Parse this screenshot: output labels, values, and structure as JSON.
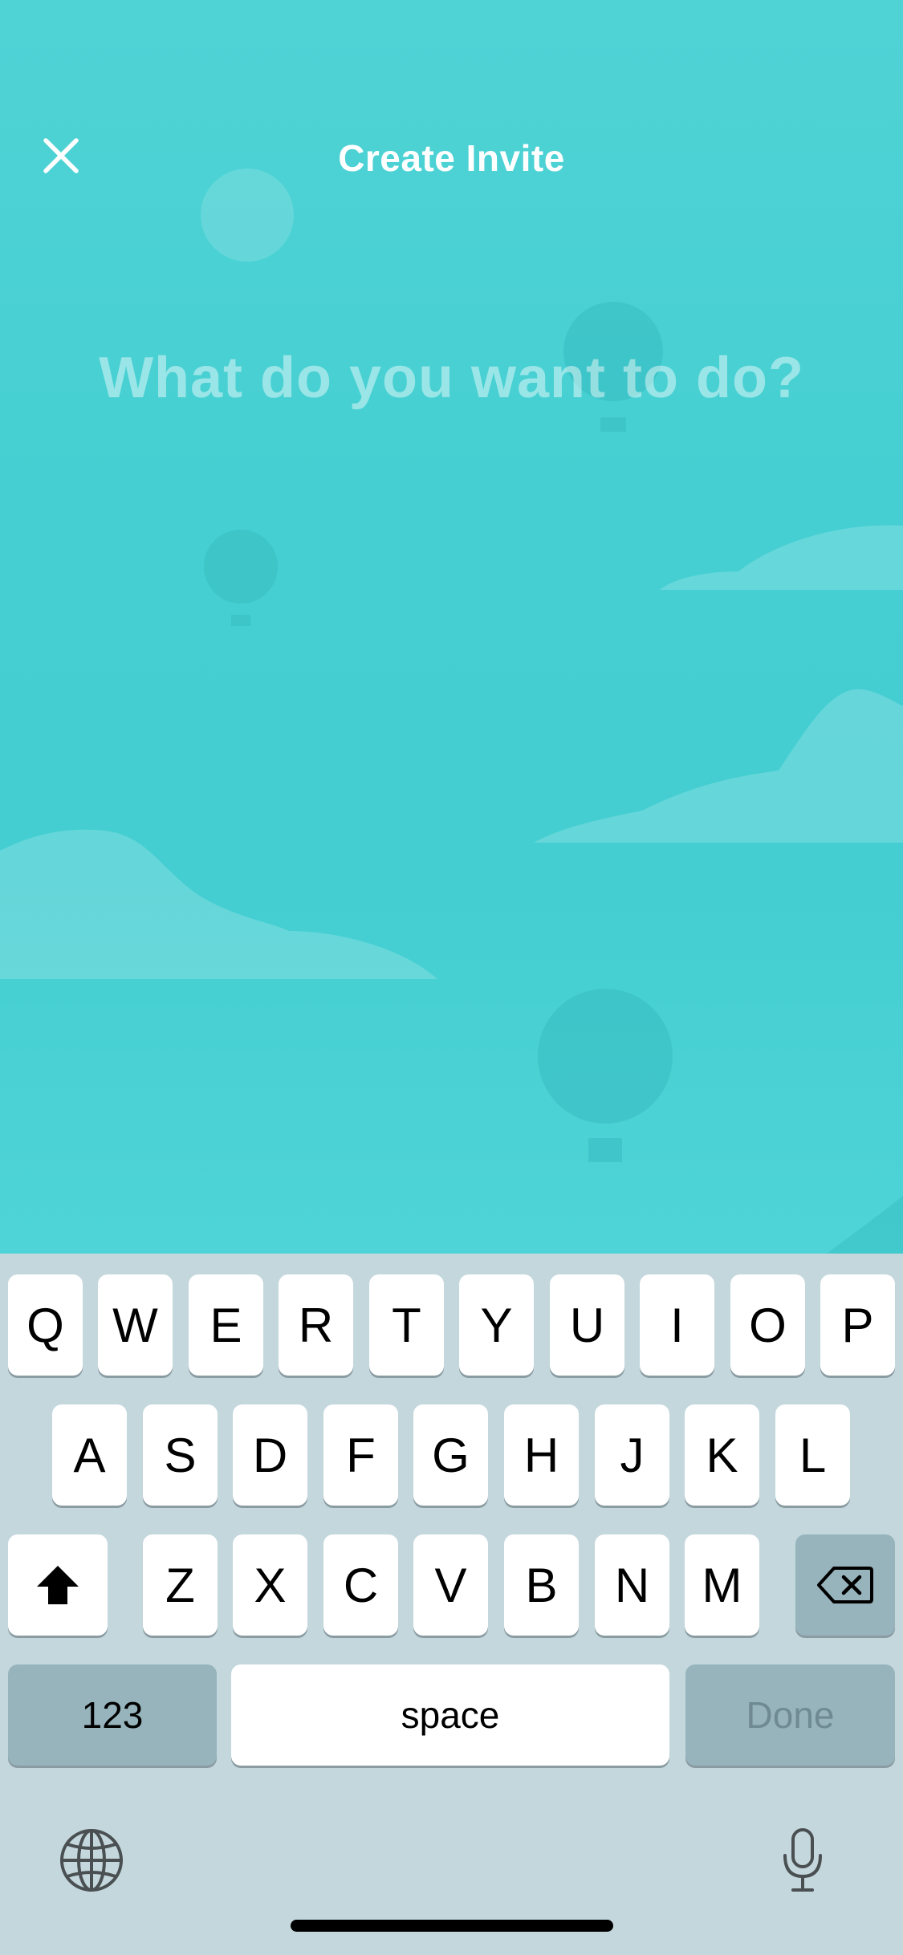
{
  "header": {
    "title": "Create Invite",
    "close_icon": "close-icon"
  },
  "main": {
    "prompt_placeholder": "What do you want to do?"
  },
  "keyboard": {
    "row1": [
      "Q",
      "W",
      "E",
      "R",
      "T",
      "Y",
      "U",
      "I",
      "O",
      "P"
    ],
    "row2": [
      "A",
      "S",
      "D",
      "F",
      "G",
      "H",
      "J",
      "K",
      "L"
    ],
    "row3": [
      "Z",
      "X",
      "C",
      "V",
      "B",
      "N",
      "M"
    ],
    "shift_icon": "shift-icon",
    "delete_icon": "backspace-icon",
    "numbers_label": "123",
    "space_label": "space",
    "done_label": "Done",
    "globe_icon": "globe-icon",
    "mic_icon": "microphone-icon"
  },
  "colors": {
    "sky": "#4dd2d2",
    "keyboard_bg": "#c3d7dd",
    "key_bg": "#ffffff",
    "key_dark_bg": "#97b4bd"
  }
}
